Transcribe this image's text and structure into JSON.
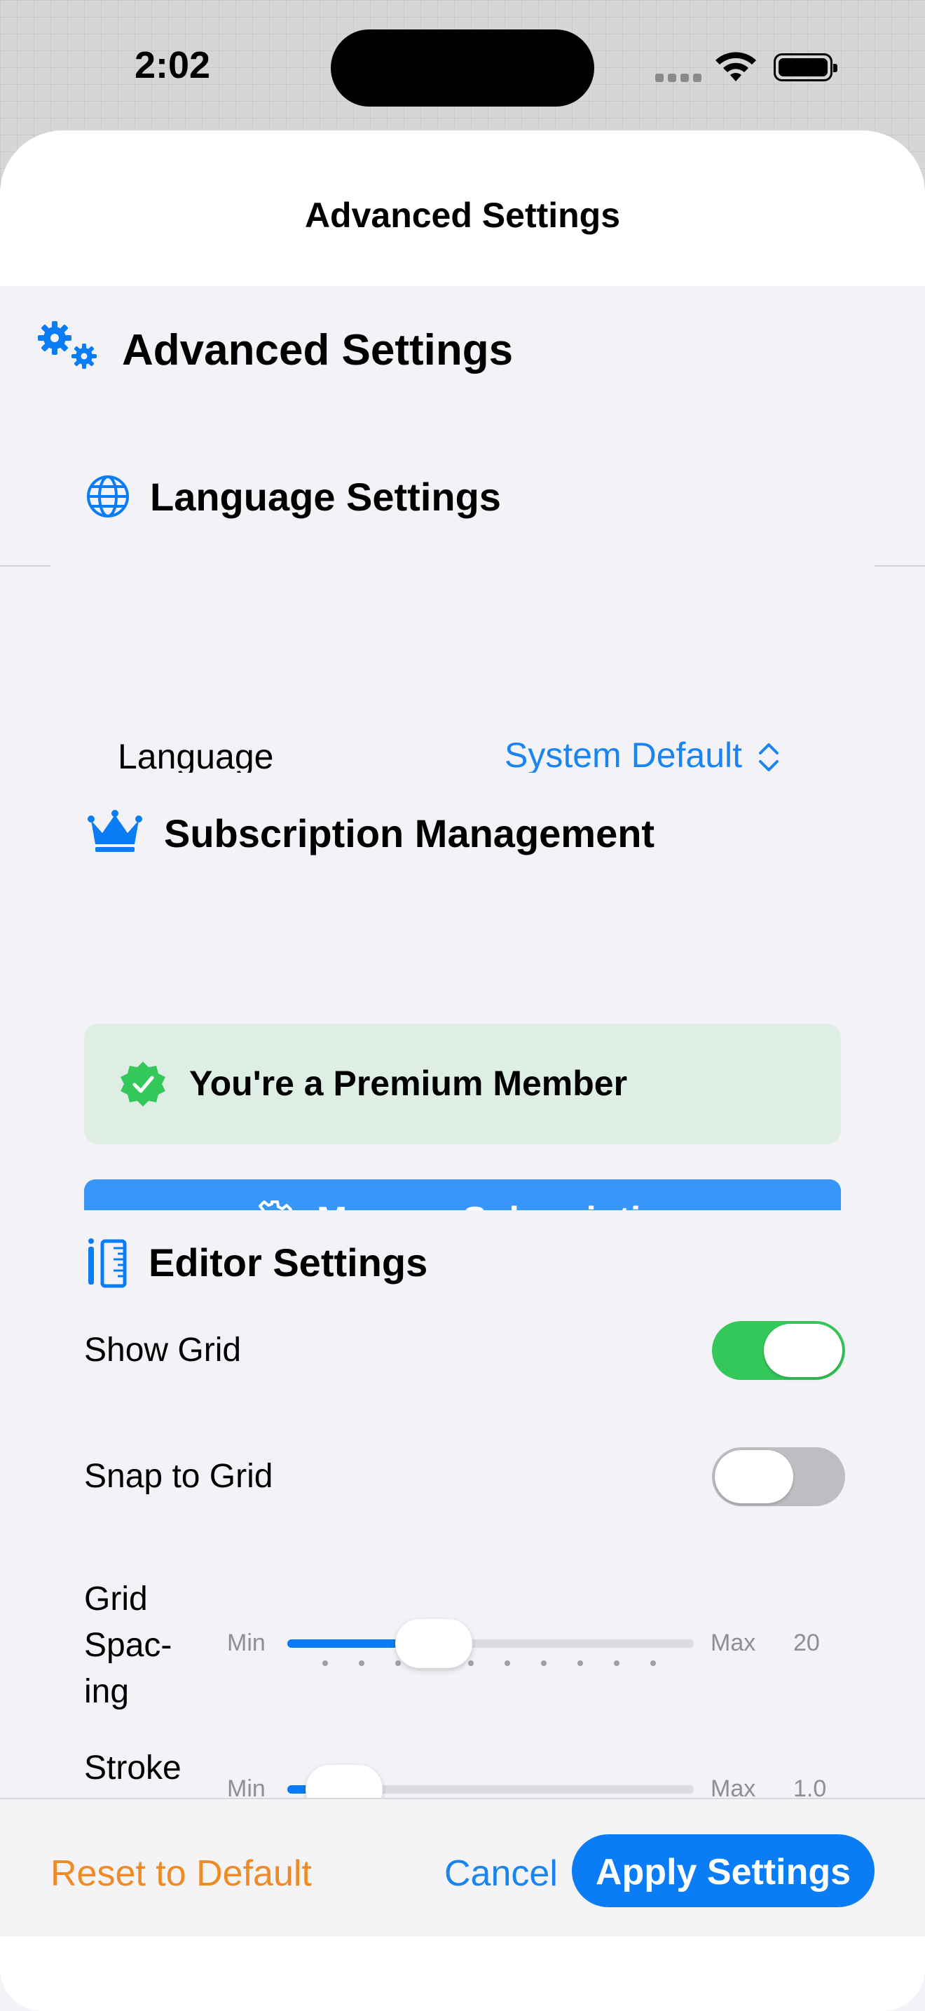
{
  "status_bar": {
    "time": "2:02"
  },
  "sheet": {
    "title": "Advanced Settings"
  },
  "header": {
    "title": "Advanced Settings",
    "icon": "gears-icon"
  },
  "language_section": {
    "title": "Language Settings",
    "icon": "globe-icon",
    "language_label": "Language",
    "language_value": "System Default"
  },
  "subscription_section": {
    "title": "Subscription Management",
    "icon": "crown-icon",
    "premium_text": "You're a Premium Member",
    "manage_label": "Manage Subscription"
  },
  "editor_section": {
    "title": "Editor Settings",
    "icon": "pencil-ruler-icon",
    "show_grid": {
      "label": "Show Grid",
      "on": true
    },
    "snap_to_grid": {
      "label": "Snap to Grid",
      "on": false
    },
    "grid_spacing": {
      "label_lines": [
        "Grid",
        "Spac-",
        "ing"
      ],
      "min_label": "Min",
      "max_label": "Max",
      "value": "20",
      "fraction": 0.36
    },
    "stroke": {
      "label": "Stroke",
      "min_label": "Min",
      "max_label": "Max",
      "value": "1.0",
      "fraction": 0.14
    }
  },
  "footer": {
    "reset_label": "Reset to Default",
    "cancel_label": "Cancel",
    "apply_label": "Apply Settings"
  },
  "colors": {
    "accent": "#0a7cf5",
    "orange": "#f08a24",
    "green": "#34c759"
  }
}
